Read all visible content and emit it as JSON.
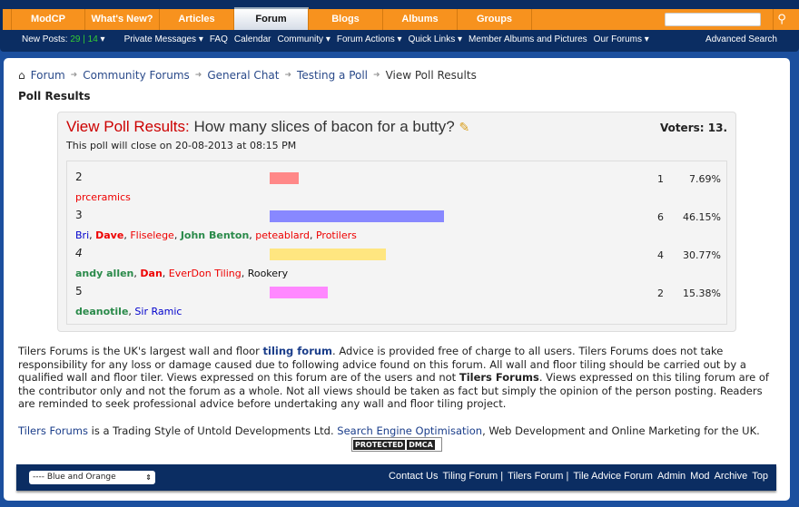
{
  "nav": {
    "tabs": [
      "ModCP",
      "What's New?",
      "Articles",
      "Forum",
      "Blogs",
      "Albums",
      "Groups"
    ],
    "selected": "Forum",
    "search_placeholder": "",
    "search_icon": "magnifier-icon"
  },
  "subnav": {
    "new_posts_label": "New Posts:",
    "new_posts_count": "29 | 14",
    "items": [
      "Private Messages ▾",
      "FAQ",
      "Calendar",
      "Community ▾",
      "Forum Actions ▾",
      "Quick Links ▾",
      "Member Albums and Pictures",
      "Our Forums ▾"
    ],
    "advanced_search": "Advanced Search"
  },
  "breadcrumb": [
    "Forum",
    "Community Forums",
    "General Chat",
    "Testing a Poll",
    "View Poll Results"
  ],
  "page_title": "Poll Results",
  "poll": {
    "label": "View Poll Results:",
    "question": "How many slices of bacon for a butty?",
    "voters_label": "Voters: 13",
    "close_text": "This poll will close on 20-08-2013 at 08:15 PM",
    "options": [
      {
        "option": "2",
        "votes": 1,
        "percent": "7.69%",
        "color": "#ff8888",
        "voters": [
          {
            "name": "prceramics",
            "color": "#e00",
            "bold": false
          }
        ]
      },
      {
        "option": "3",
        "votes": 6,
        "percent": "46.15%",
        "color": "#8888ff",
        "voters": [
          {
            "name": "Bri",
            "color": "#00c",
            "bold": false
          },
          {
            "name": "Dave",
            "color": "#e00",
            "bold": true
          },
          {
            "name": "Fliselege",
            "color": "#e00",
            "bold": false
          },
          {
            "name": "John Benton",
            "color": "#2a8a4a",
            "bold": true
          },
          {
            "name": "peteablard",
            "color": "#e00",
            "bold": false
          },
          {
            "name": "Protilers",
            "color": "#e00",
            "bold": false
          }
        ]
      },
      {
        "option": "4",
        "votes": 4,
        "percent": "30.77%",
        "color": "#ffe680",
        "voters": [
          {
            "name": "andy allen",
            "color": "#2a8a4a",
            "bold": true
          },
          {
            "name": "Dan",
            "color": "#e00",
            "bold": true
          },
          {
            "name": "EverDon Tiling",
            "color": "#e00",
            "bold": false
          },
          {
            "name": "Rookery",
            "color": "#111",
            "bold": false
          }
        ]
      },
      {
        "option": "5",
        "votes": 2,
        "percent": "15.38%",
        "color": "#ff88ff",
        "voters": [
          {
            "name": "deanotile",
            "color": "#2a8a4a",
            "bold": true
          },
          {
            "name": "Sir Ramic",
            "color": "#00c",
            "bold": false
          }
        ]
      }
    ]
  },
  "disclaimer": {
    "p1": "Tilers Forums is the UK's largest wall and floor ",
    "link1": "tiling forum",
    "p2": ". Advice is provided free of charge to all users. Tilers Forums does not take responsibility for any loss or damage caused due to following advice found on this forum. All wall and floor tiling should be carried out by a qualified wall and floor tiler. Views expressed on this forum are of the users and not ",
    "bold1": "Tilers Forums",
    "p3": ". Views expressed on this tiling forum are of the contributor only and not the forum as a whole. Not all views should be taken as fact but simply the opinion of the person posting. Readers are reminded to seek professional advice before undertaking any wall and floor tiling project."
  },
  "trade": {
    "link1": "Tilers Forums",
    "t1": " is a Trading Style of Untold Developments Ltd. ",
    "link2": "Search Engine Optimisation",
    "t2": ", Web Development and Online Marketing for the UK."
  },
  "dmca": {
    "a": "PROTECTED",
    "b": "DMCA"
  },
  "footer": {
    "style_select": "---- Blue and Orange",
    "links": [
      "Contact Us",
      "Tiling Forum |",
      "Tilers Forum |",
      "Tile Advice Forum",
      "Admin",
      "Mod",
      "Archive",
      "Top"
    ]
  }
}
